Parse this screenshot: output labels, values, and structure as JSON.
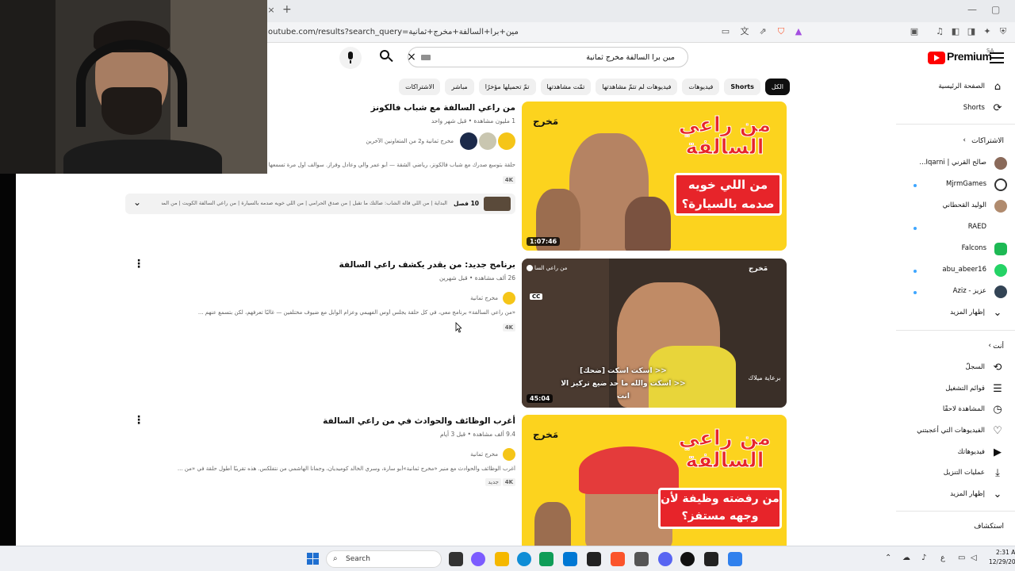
{
  "browser": {
    "url": "outube.com/results?search_query=مين+برا+السالفة+مخرج+ثمانية",
    "tab_close": "×",
    "new_tab": "+"
  },
  "masthead": {
    "logo_text": "Premium",
    "logo_region": "SA",
    "search_value": "مين برا السالفة مخرج ثمانية",
    "clear_label": "×"
  },
  "chips": [
    "الكل",
    "Shorts",
    "فيديوهات",
    "فيديوهات لم تتمّ مشاهدتها",
    "تمّت مشاهدتها",
    "تمّ تحميلها مؤخرًا",
    "مباشر",
    "الاشتراكات"
  ],
  "sidebar": {
    "home": "الصفحة الرئيسية",
    "shorts": "Shorts",
    "subscriptions_header": "الاشتراكات",
    "subscriptions": [
      {
        "name": "صالح القرني | Iqarni...",
        "color": "#8a6a5a",
        "dot": false
      },
      {
        "name": "MjrmGames",
        "color": "#333333",
        "dot": true
      },
      {
        "name": "الوليد القحطاني",
        "color": "#b08b6e",
        "dot": false
      },
      {
        "name": "RAED",
        "color": "#ffffff",
        "dot": true
      },
      {
        "name": "Falcons",
        "color": "#1db954",
        "dot": false
      },
      {
        "name": "abu_abeer16",
        "color": "#25d366",
        "dot": true
      },
      {
        "name": "عزيز - Aziz",
        "color": "#334455",
        "dot": true
      }
    ],
    "show_more_1": "إظهار المزيد",
    "you_header": "أنت",
    "you_items": [
      {
        "label": "السجلّ",
        "icon": "history-icon",
        "glyph": "⟲"
      },
      {
        "label": "قوائم التشغيل",
        "icon": "playlists-icon",
        "glyph": "☰"
      },
      {
        "label": "المشاهدة لاحقًا",
        "icon": "watch-later-icon",
        "glyph": "◷"
      },
      {
        "label": "الفيديوهات التي أعجبتني",
        "icon": "like-icon",
        "glyph": "👍"
      },
      {
        "label": "فيديوهاتك",
        "icon": "your-videos-icon",
        "glyph": "▶"
      },
      {
        "label": "عمليات التنزيل",
        "icon": "download-icon",
        "glyph": "⤓"
      }
    ],
    "show_more_2": "إظهار المزيد",
    "explore_header": "استكشاف"
  },
  "results": [
    {
      "title": "من راعي السالفة مع شباب فالكونز",
      "meta": "1 مليون مشاهدة • قبل شهر واحد",
      "channel": "مخرج ثمانية و2 من المتعاونين الآخرين",
      "description": "حلقة بتوسع صدرك مع شباب فالكونز، رياضي الشقة — أبو عمر والي وعادل وفراز. سوالف أول مرة تسمعها منهم حتى هم ما...",
      "badge": "4K",
      "duration": "1:07:46",
      "thumb_title": "من راعي السالفة",
      "thumb_caption": "من اللي خويه صدمه بالسيارة؟",
      "brand": "مَخرج"
    },
    {
      "title": "برنامج جديد: من يقدر يكشف راعي السالفة",
      "meta": "26 ألف مشاهدة • قبل شهرين",
      "channel": "مخرج ثمانية",
      "description": "«من راعي السالفة» برنامج معي، في كل حلقة يجلس أوس الفهيمي وعزام الوابل مع ضيوف مختلفين — غالبًا تعرفهم، لكن بتسمع عنهم ...",
      "badge": "4K",
      "duration": "45:04",
      "overlay_channel": "من راعي السا",
      "brand": "مَخرج",
      "sub_line_1": "<< اسكت اسكت [ضحك]",
      "sub_line_2": "<< اسكت والله ما حد ضيع تركيز الا انت",
      "sponsor": "برعاية ميلاك",
      "cc": "CC"
    },
    {
      "title": "أغرب الوظائف والحوادث في من راعي السالفة",
      "meta": "9.4 ألف مشاهدة • قبل 3 أيام",
      "channel": "مخرج ثمانية",
      "description": "أغرب الوظائف والحوادث مع منير «مخرج ثمانية»أبو سارة، وسري الخالد كوميديان، وجمانا الهاشمي من نتفلكس. هذه تقريبًا أطول حلقة في «من ...",
      "badge": "4K",
      "badge2": "جديد",
      "thumb_title": "من راعي السالفة",
      "thumb_caption": "من رفضته وظيفة لأن وجهه مستفز؟",
      "brand": "مَخرج"
    }
  ],
  "chapters": {
    "count": "10 فصل",
    "text": "البداية | من اللي قاله الشاب: صالتك ما تقبل | من صدق الحرامي | من اللي خويه صدمه بالسيارة | من راعي السالفة الكويت | من المشهور | من يشرب..."
  },
  "taskbar": {
    "search": "Search",
    "time": "2:31 A",
    "date": "12/29/20",
    "lang": "ع"
  }
}
